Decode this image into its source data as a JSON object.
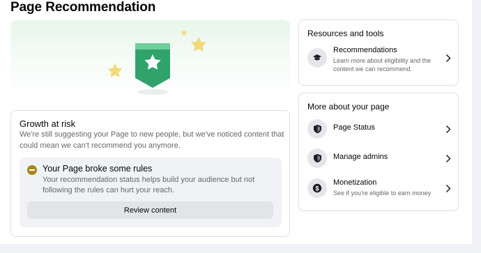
{
  "page_title": "Page Recommendation",
  "growth": {
    "heading": "Growth at risk",
    "description": "We're still suggesting your Page to new people, but we've noticed content that could mean we can't recommend you anymore.",
    "rules_heading": "Your Page broke some rules",
    "rules_description": "Your recommendation status helps build your audience but not following the rules can hurt your reach.",
    "review_button": "Review content"
  },
  "resources": {
    "heading": "Resources and tools",
    "items": [
      {
        "label": "Recommendations",
        "sub": "Learn more about eligibility and the content we can recommend.",
        "icon": "graduation-cap-icon"
      }
    ]
  },
  "more": {
    "heading": "More about your page",
    "items": [
      {
        "label": "Page Status",
        "sub": "",
        "icon": "shield-icon"
      },
      {
        "label": "Manage admins",
        "sub": "",
        "icon": "shield-icon"
      },
      {
        "label": "Monetization",
        "sub": "See if you're eligible to earn money",
        "icon": "dollar-icon"
      }
    ]
  },
  "colors": {
    "badge_green": "#2fa36b",
    "star_gold": "#f2d46b",
    "warning": "#a8861f"
  }
}
